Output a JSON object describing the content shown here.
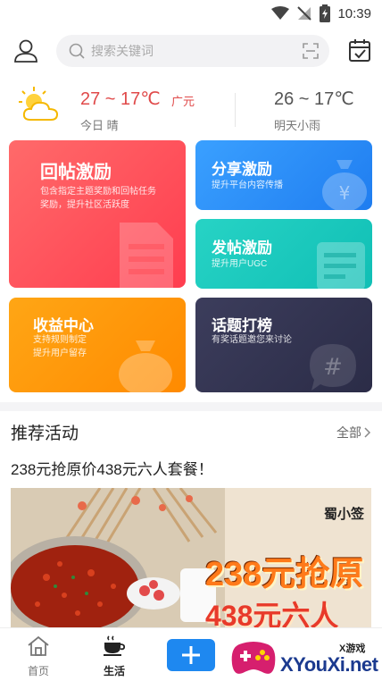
{
  "status_bar": {
    "time": "10:39"
  },
  "header": {
    "search_placeholder": "搜索关键词"
  },
  "weather": {
    "today_temp": "27 ~ 17℃",
    "city": "广元",
    "today_desc": "今日 晴",
    "tomorrow_temp": "26 ~ 17℃",
    "tomorrow_desc": "明天小雨"
  },
  "cards": {
    "reply_reward": {
      "title": "回帖激励",
      "desc": "包含指定主题奖励和回帖任务奖励，提升社区活跃度"
    },
    "share_reward": {
      "title": "分享激励",
      "desc": "提升平台内容传播"
    },
    "post_reward": {
      "title": "发帖激励",
      "desc": "提升用户UGC"
    },
    "income_center": {
      "title": "收益中心",
      "desc_line1": "支持规则制定",
      "desc_line2": "提升用户留存"
    },
    "topic_ranking": {
      "title": "话题打榜",
      "desc": "有奖话题邀您来讨论"
    }
  },
  "recommended": {
    "section_title": "推荐活动",
    "more_label": "全部",
    "activity_title": "238元抢原价438元六人套餐！",
    "banner": {
      "brand": "蜀小签",
      "line1": "238元抢原",
      "line2": "438元六人"
    }
  },
  "bottom_nav": {
    "home_label": "首页",
    "life_label": "生活",
    "watermark_text": "XYouXi.net",
    "watermark_sub": "X游戏"
  },
  "colors": {
    "accent_blue": "#1e88f0",
    "weather_red": "#e04a4a",
    "card_red": "#ff4d5a",
    "card_blue": "#2b8ef5",
    "card_teal": "#1cc8bd",
    "card_orange": "#ff9a0b",
    "card_navy": "#33344f"
  },
  "icons": {
    "user": "user-icon",
    "search": "search-icon",
    "scan": "scan-icon",
    "calendar": "calendar-check-icon",
    "weather": "sun-cloud-icon",
    "home": "home-icon",
    "life": "coffee-cup-icon",
    "plus": "plus-icon"
  }
}
